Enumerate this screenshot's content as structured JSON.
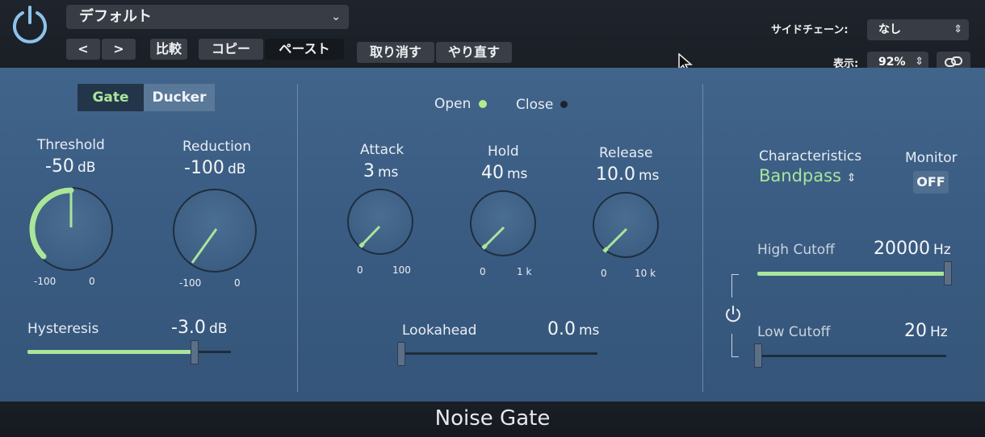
{
  "header": {
    "preset": "デフォルト",
    "nav_prev": "<",
    "nav_next": ">",
    "compare": "比較",
    "copy": "コピー",
    "paste": "ペースト",
    "undo": "取り消す",
    "redo": "やり直す",
    "sidechain_label": "サイドチェーン:",
    "sidechain_value": "なし",
    "zoom_label": "表示:",
    "zoom_value": "92%"
  },
  "mode": {
    "gate": "Gate",
    "ducker": "Ducker",
    "selected": "Gate"
  },
  "threshold": {
    "label": "Threshold",
    "value": "-50",
    "unit": "dB",
    "min": "-100",
    "max": "0"
  },
  "reduction": {
    "label": "Reduction",
    "value": "-100",
    "unit": "dB",
    "min": "-100",
    "max": "0"
  },
  "hysteresis": {
    "label": "Hysteresis",
    "value": "-3.0",
    "unit": "dB",
    "level": 0.82
  },
  "status": {
    "open": "Open",
    "close": "Close",
    "open_color": "#b6ec8e",
    "close_color": "#1a2430"
  },
  "attack": {
    "label": "Attack",
    "value": "3",
    "unit": "ms",
    "min": "0",
    "max": "100"
  },
  "hold": {
    "label": "Hold",
    "value": "40",
    "unit": "ms",
    "min": "0",
    "max": "1 k"
  },
  "release": {
    "label": "Release",
    "value": "10.0",
    "unit": "ms",
    "min": "0",
    "max": "10 k"
  },
  "lookahead": {
    "label": "Lookahead",
    "value": "0.0",
    "unit": "ms",
    "level": 0.0
  },
  "filter": {
    "characteristics_label": "Characteristics",
    "characteristics_value": "Bandpass",
    "monitor_label": "Monitor",
    "monitor_value": "OFF",
    "high_cutoff_label": "High Cutoff",
    "high_cutoff_value": "20000",
    "high_cutoff_unit": "Hz",
    "high_cutoff_level": 1.0,
    "low_cutoff_label": "Low Cutoff",
    "low_cutoff_value": "20",
    "low_cutoff_unit": "Hz",
    "low_cutoff_level": 0.0
  },
  "footer": {
    "title": "Noise Gate"
  },
  "colors": {
    "accent": "#a9e59b",
    "panel": "#3d5f86",
    "header": "#1c2128"
  }
}
